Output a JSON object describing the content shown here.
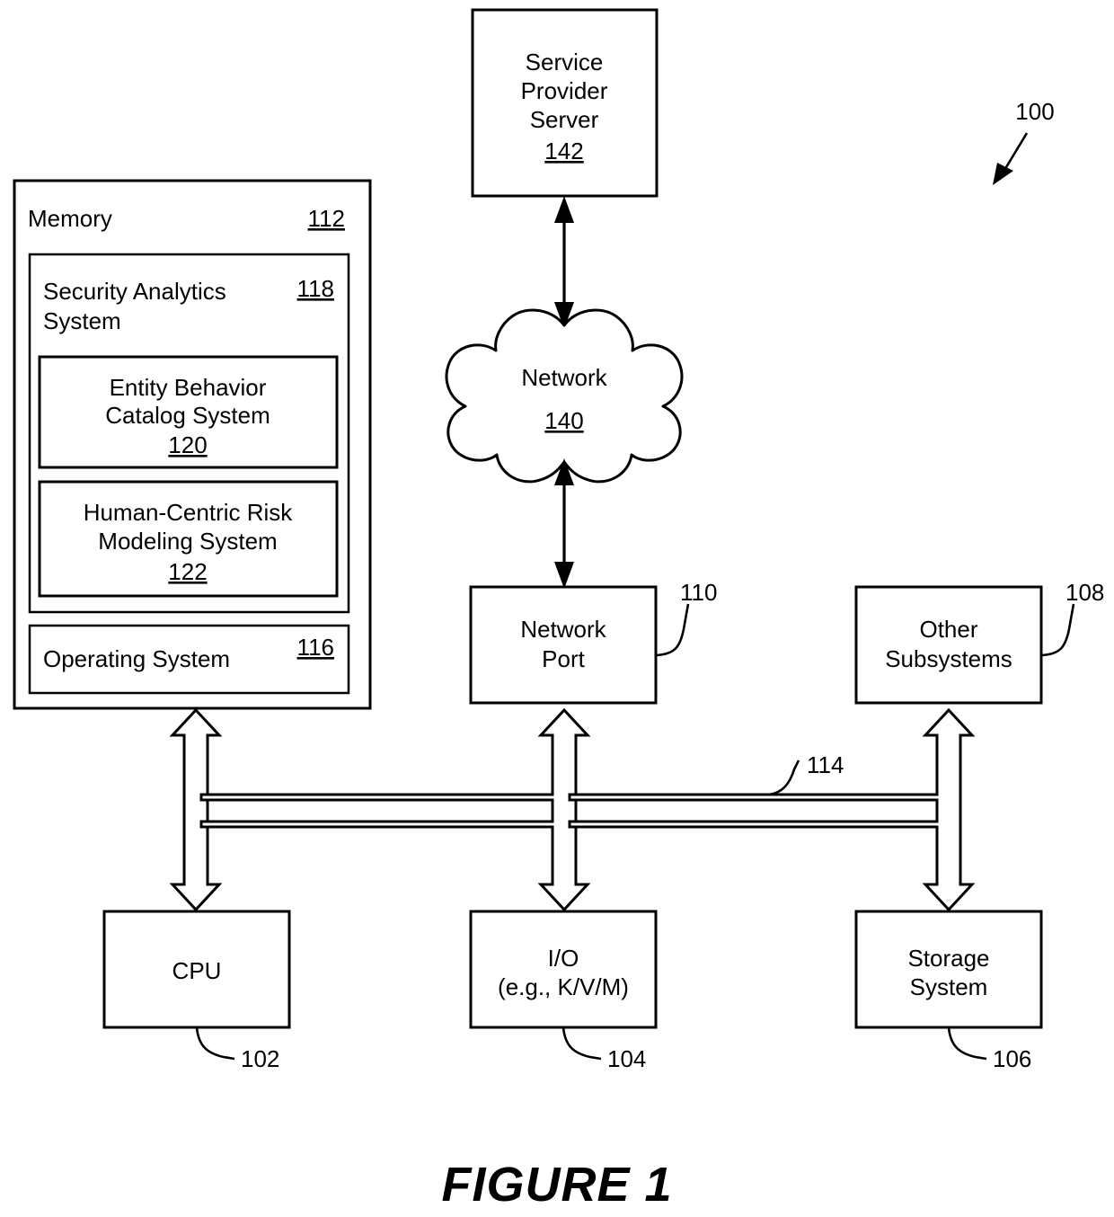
{
  "figure": {
    "caption": "FIGURE 1",
    "system_ref": "100"
  },
  "blocks": {
    "service_provider_server": {
      "lines": [
        "Service",
        "Provider",
        "Server"
      ],
      "ref": "142"
    },
    "network_cloud": {
      "label": "Network",
      "ref": "140"
    },
    "memory": {
      "label": "Memory",
      "ref": "112"
    },
    "security_analytics_system": {
      "lines": [
        "Security Analytics",
        "System"
      ],
      "ref": "118"
    },
    "entity_behavior_catalog_system": {
      "lines": [
        "Entity Behavior",
        "Catalog System"
      ],
      "ref": "120"
    },
    "human_centric_risk_modeling_system": {
      "lines": [
        "Human-Centric Risk",
        "Modeling System"
      ],
      "ref": "122"
    },
    "operating_system": {
      "label": "Operating System",
      "ref": "116"
    },
    "network_port": {
      "lines": [
        "Network",
        "Port"
      ],
      "ref": "110"
    },
    "other_subsystems": {
      "lines": [
        "Other",
        "Subsystems"
      ],
      "ref": "108"
    },
    "cpu": {
      "label": "CPU",
      "ref": "102"
    },
    "io": {
      "lines": [
        "I/O",
        "(e.g., K/V/M)"
      ],
      "ref": "104"
    },
    "storage_system": {
      "lines": [
        "Storage",
        "System"
      ],
      "ref": "106"
    },
    "bus": {
      "ref": "114"
    }
  },
  "colors": {
    "stroke": "#000000",
    "fill": "#ffffff"
  }
}
